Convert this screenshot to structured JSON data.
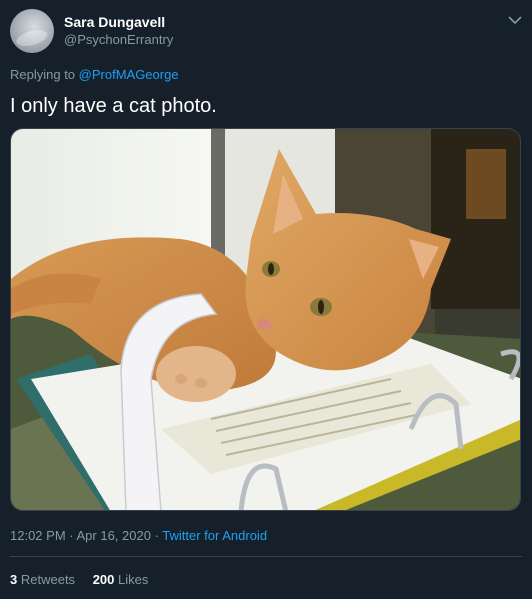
{
  "author": {
    "name": "Sara Dungavell",
    "handle": "@PsychonErrantry"
  },
  "reply": {
    "prefix": "Replying to ",
    "mention": "@ProfMAGeorge"
  },
  "tweet": {
    "text": "I only have a cat photo."
  },
  "meta": {
    "time": "12:02 PM",
    "separator1": " · ",
    "date": "Apr 16, 2020",
    "separator2": " · ",
    "source": "Twitter for Android"
  },
  "stats": {
    "retweets_count": "3",
    "retweets_label": "Retweets",
    "likes_count": "200",
    "likes_label": "Likes"
  },
  "colors": {
    "background": "#15202b",
    "text": "#ffffff",
    "secondary": "#8899a6",
    "accent": "#1da1f2",
    "border": "#38444d"
  },
  "icons": {
    "caret": "chevron-down-icon"
  }
}
